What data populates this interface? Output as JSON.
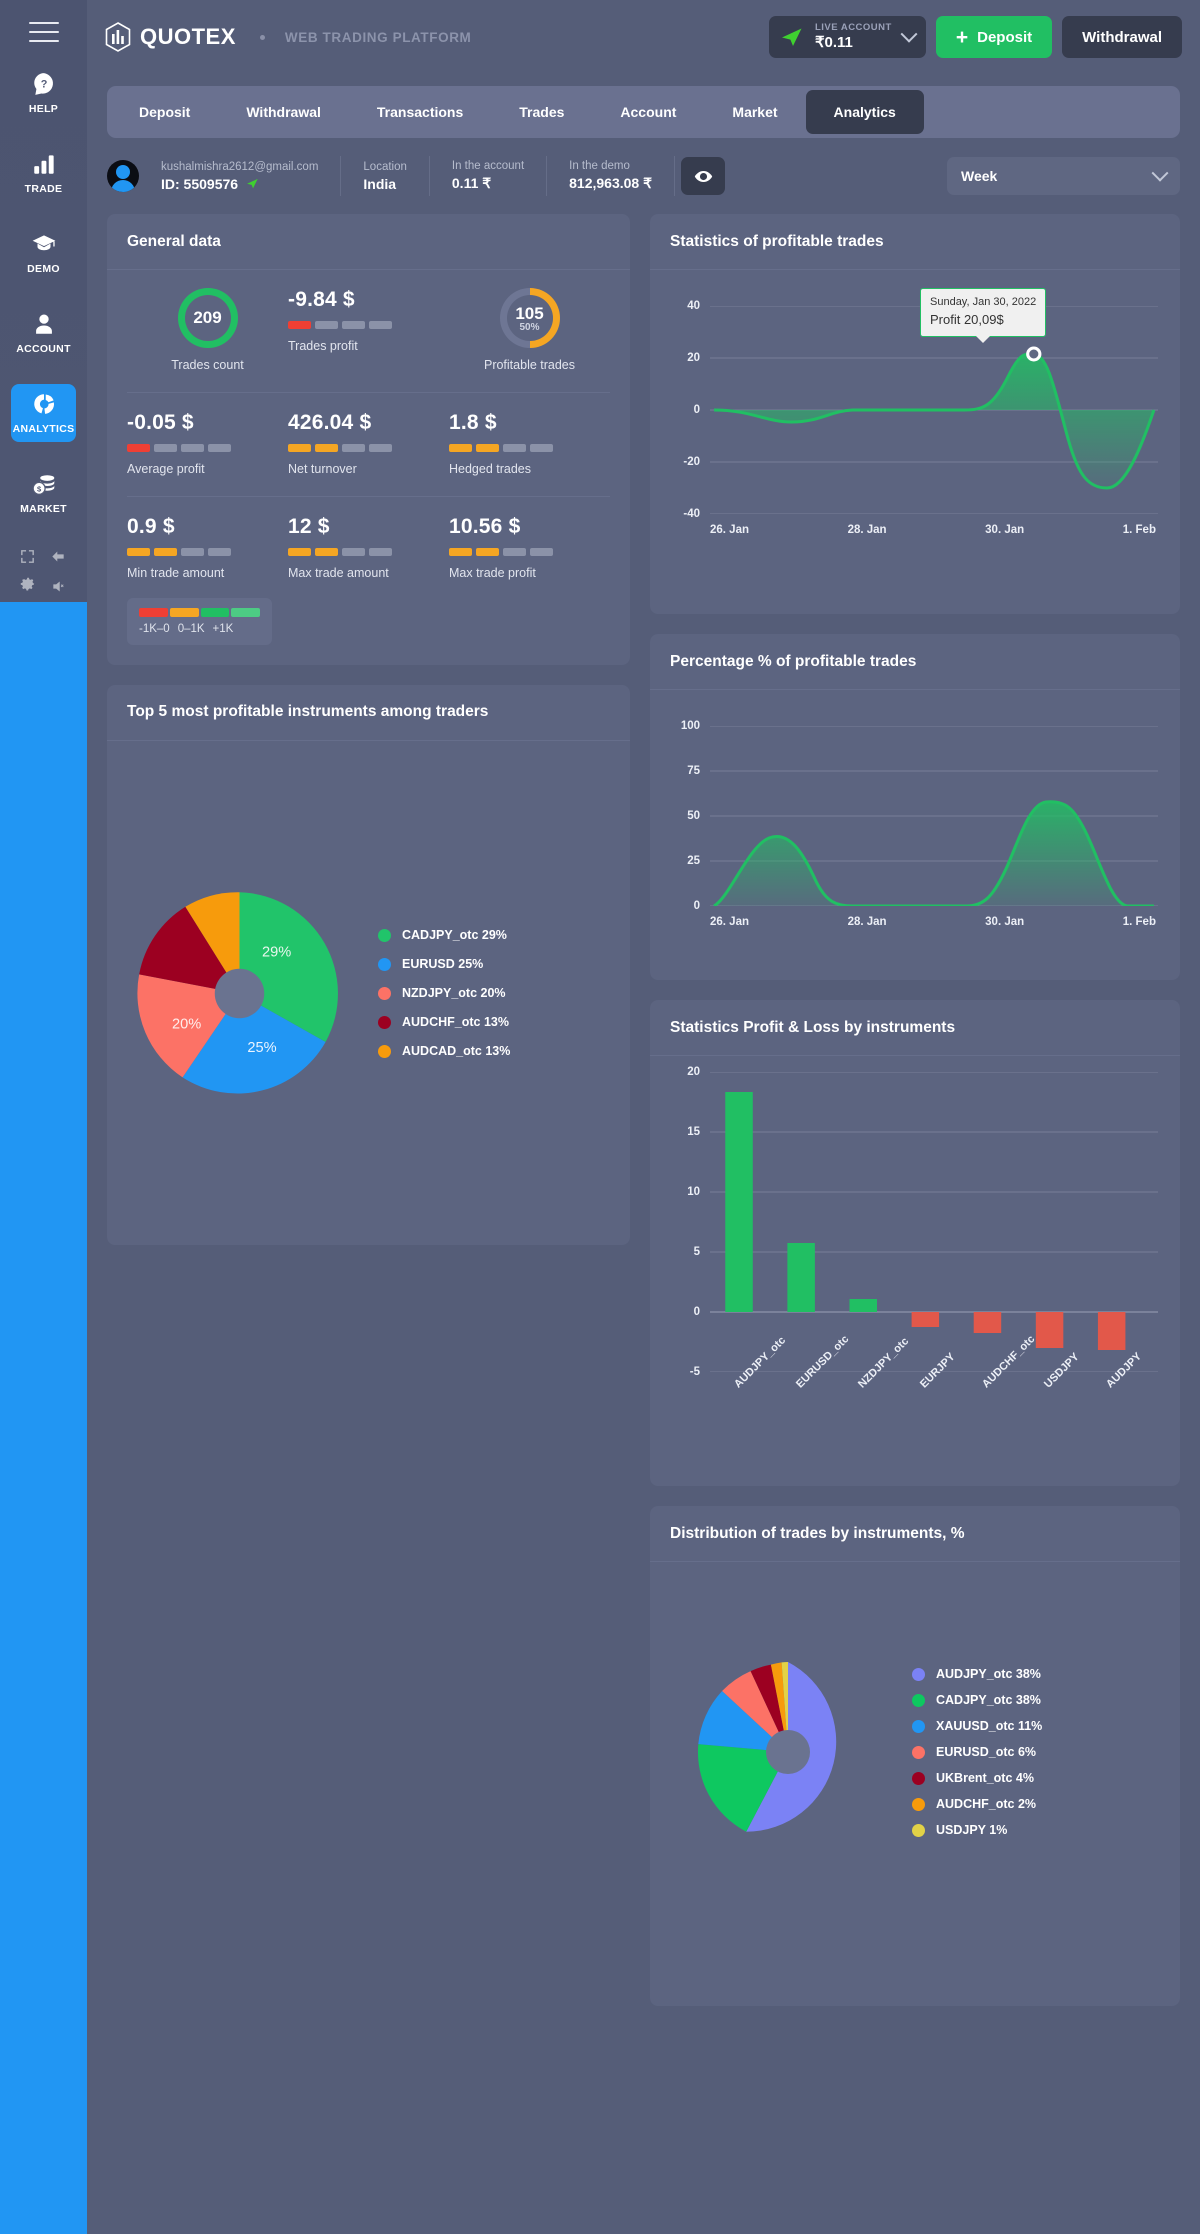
{
  "brand": {
    "logo_text": "QUOTEX",
    "platform": "WEB TRADING PLATFORM"
  },
  "header": {
    "account_label": "LIVE ACCOUNT",
    "account_balance": "₹0.11",
    "deposit_label": "Deposit",
    "withdrawal_label": "Withdrawal"
  },
  "rail": {
    "items": [
      {
        "label": "HELP",
        "icon": "help-icon"
      },
      {
        "label": "TRADE",
        "icon": "chart-bars-icon"
      },
      {
        "label": "DEMO",
        "icon": "graduation-cap-icon"
      },
      {
        "label": "ACCOUNT",
        "icon": "user-icon"
      },
      {
        "label": "ANALYTICS",
        "icon": "donut-chart-icon"
      },
      {
        "label": "MARKET",
        "icon": "coins-icon"
      }
    ]
  },
  "tabs": [
    {
      "label": "Deposit"
    },
    {
      "label": "Withdrawal"
    },
    {
      "label": "Transactions"
    },
    {
      "label": "Trades"
    },
    {
      "label": "Account"
    },
    {
      "label": "Market"
    },
    {
      "label": "Analytics"
    }
  ],
  "active_tab": "Analytics",
  "user": {
    "email": "kushalmishra2612@gmail.com",
    "id": "ID: 5509576",
    "location_label": "Location",
    "location_value": "India",
    "account_label": "In the account",
    "account_value": "0.11 ₹",
    "demo_label": "In the demo",
    "demo_value": "812,963.08 ₹"
  },
  "period": {
    "value": "Week"
  },
  "general": {
    "title": "General data",
    "row1": [
      {
        "value": "209",
        "caption": "Trades count",
        "kind": "ring",
        "ring_pct": 100,
        "ring_color": "#21bf63"
      },
      {
        "value": "-9.84 $",
        "caption": "Trades profit",
        "kind": "bars",
        "filled": 1,
        "fill_color": "#ef3f34"
      },
      {
        "value": "105",
        "sub": "50%",
        "caption": "Profitable trades",
        "kind": "ring",
        "ring_pct": 50,
        "ring_color": "#f5a623"
      }
    ],
    "row2": [
      {
        "value": "-0.05 $",
        "caption": "Average profit",
        "kind": "bars",
        "filled": 1,
        "fill_color": "#ef3f34"
      },
      {
        "value": "426.04 $",
        "caption": "Net turnover",
        "kind": "bars",
        "filled": 2,
        "fill_color": "#f5a623"
      },
      {
        "value": "1.8 $",
        "caption": "Hedged trades",
        "kind": "bars",
        "filled": 2,
        "fill_color": "#f5a623"
      }
    ],
    "row3": [
      {
        "value": "0.9 $",
        "caption": "Min trade amount",
        "kind": "bars",
        "filled": 2,
        "fill_color": "#f5a623"
      },
      {
        "value": "12 $",
        "caption": "Max trade amount",
        "kind": "bars",
        "filled": 2,
        "fill_color": "#f5a623"
      },
      {
        "value": "10.56 $",
        "caption": "Max trade profit",
        "kind": "bars",
        "filled": 2,
        "fill_color": "#f5a623"
      }
    ],
    "scale_legend": {
      "labels": [
        "-1K–0",
        "0–1K",
        "+1K"
      ],
      "colors": [
        "#ef3f34",
        "#f5a623",
        "#21bf63",
        "#4dcb84"
      ]
    }
  },
  "cards": {
    "top5_title": "Top 5 most profitable instruments among traders",
    "profitable_title": "Statistics of profitable trades",
    "percentage_title": "Percentage % of profitable trades",
    "pl_title": "Statistics Profit & Loss by instruments",
    "distribution_title": "Distribution of trades by instruments, %"
  },
  "tooltip": {
    "line1": "Sunday, Jan 30, 2022",
    "line2": "Profit 20,09$"
  },
  "chart_data": [
    {
      "id": "profitable-trades",
      "type": "area",
      "title": "Statistics of profitable trades",
      "xlabel": "",
      "ylabel": "",
      "ylim": [
        -40,
        40
      ],
      "yticks": [
        40,
        20,
        0,
        -20,
        -40
      ],
      "xticks": [
        "26. Jan",
        "28. Jan",
        "30. Jan",
        "1. Feb"
      ],
      "grid": true,
      "legend": "none",
      "line_color": "#21bf63",
      "x": [
        "25. Jan",
        "26. Jan",
        "27. Jan",
        "28. Jan",
        "29. Jan",
        "30. Jan",
        "31. Jan",
        "1. Feb"
      ],
      "values": [
        0,
        -4.5,
        -0.5,
        0,
        0,
        20.09,
        -27,
        0
      ],
      "annotation": {
        "x": "30. Jan",
        "y": 20.09,
        "text": "Sunday, Jan 30, 2022 / Profit 20,09$"
      }
    },
    {
      "id": "percentage-profitable",
      "type": "area",
      "title": "Percentage % of profitable trades",
      "xlabel": "",
      "ylabel": "",
      "ylim": [
        0,
        100
      ],
      "yticks": [
        100,
        75,
        50,
        25,
        0
      ],
      "xticks": [
        "26. Jan",
        "28. Jan",
        "30. Jan",
        "1. Feb"
      ],
      "grid": true,
      "legend": "none",
      "line_color": "#21bf63",
      "x": [
        "25. Jan",
        "26. Jan",
        "27. Jan",
        "28. Jan",
        "29. Jan",
        "30. Jan",
        "31. Jan",
        "1. Feb"
      ],
      "values": [
        0,
        38,
        0,
        0,
        0,
        57,
        52,
        0
      ]
    },
    {
      "id": "top5-instruments",
      "type": "pie",
      "title": "Top 5 most profitable instruments among traders",
      "legend": "right",
      "labels": [
        "CADJPY_otc",
        "EURUSD",
        "NZDJPY_otc",
        "AUDCHF_otc",
        "AUDCAD_otc"
      ],
      "values": [
        29,
        25,
        20,
        13,
        13
      ],
      "colors": [
        "#21c46a",
        "#2196f3",
        "#fc7266",
        "#9c0021",
        "#f79b0c"
      ],
      "legend_entries": [
        "CADJPY_otc 29%",
        "EURUSD 25%",
        "NZDJPY_otc 20%",
        "AUDCHF_otc 13%",
        "AUDCAD_otc 13%"
      ],
      "slice_labels": [
        "29%",
        "25%",
        "20%",
        "",
        ""
      ]
    },
    {
      "id": "profit-loss-instruments",
      "type": "bar",
      "title": "Statistics Profit & Loss by instruments",
      "xlabel": "",
      "ylabel": "",
      "ylim": [
        -5,
        20
      ],
      "yticks": [
        20,
        15,
        10,
        5,
        0,
        -5
      ],
      "grid": true,
      "legend": "none",
      "categories": [
        "AUDJPY_otc",
        "EURUSD_otc",
        "NZDJPY_otc",
        "EURJPY",
        "AUDCHF_otc",
        "USDJPY",
        "AUDJPY"
      ],
      "values": [
        18.3,
        5.7,
        1.1,
        -1.2,
        -1.7,
        -3.0,
        -3.1
      ],
      "positive_color": "#21bf63",
      "negative_color": "#e2584a"
    },
    {
      "id": "distribution-instruments",
      "type": "pie",
      "title": "Distribution of trades by instruments, %",
      "legend": "right",
      "labels": [
        "AUDJPY_otc",
        "CADJPY_otc",
        "XAUUSD_otc",
        "EURUSD_otc",
        "UKBrent_otc",
        "AUDCHF_otc",
        "USDJPY"
      ],
      "values": [
        38,
        38,
        11,
        6,
        4,
        2,
        1
      ],
      "colors": [
        "#7b82f5",
        "#0ec860",
        "#2196f3",
        "#fc7266",
        "#9c0021",
        "#f79b0c",
        "#e2d247"
      ],
      "legend_entries": [
        "AUDJPY_otc 38%",
        "CADJPY_otc 38%",
        "XAUUSD_otc 11%",
        "EURUSD_otc 6%",
        "UKBrent_otc 4%",
        "AUDCHF_otc 2%",
        "USDJPY 1%"
      ],
      "slice_labels": [
        "",
        "",
        "",
        "",
        "",
        "",
        ""
      ]
    }
  ]
}
